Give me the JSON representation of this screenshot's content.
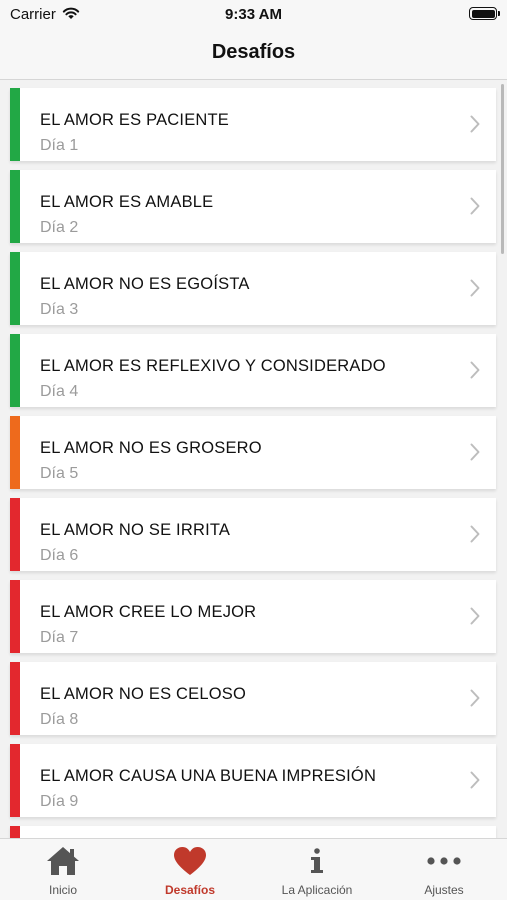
{
  "status_bar": {
    "carrier": "Carrier",
    "time": "9:33 AM"
  },
  "nav": {
    "title": "Desafíos"
  },
  "challenges": [
    {
      "title": "EL AMOR ES PACIENTE",
      "day": "Día 1",
      "color": "#22a845"
    },
    {
      "title": "EL AMOR ES AMABLE",
      "day": "Día 2",
      "color": "#22a845"
    },
    {
      "title": "EL AMOR NO ES EGOÍSTA",
      "day": "Día 3",
      "color": "#22a845"
    },
    {
      "title": "EL AMOR ES REFLEXIVO Y CONSIDERADO",
      "day": "Día 4",
      "color": "#22a845"
    },
    {
      "title": "EL AMOR NO ES GROSERO",
      "day": "Día 5",
      "color": "#ee6a1c"
    },
    {
      "title": "EL AMOR NO SE IRRITA",
      "day": "Día 6",
      "color": "#e3282e"
    },
    {
      "title": "EL AMOR CREE LO MEJOR",
      "day": "Día 7",
      "color": "#e3282e"
    },
    {
      "title": "EL AMOR NO ES CELOSO",
      "day": "Día 8",
      "color": "#e3282e"
    },
    {
      "title": "EL AMOR CAUSA UNA BUENA IMPRESIÓN",
      "day": "Día 9",
      "color": "#e3282e"
    },
    {
      "title": "",
      "day": "",
      "color": "#e3282e"
    }
  ],
  "tabs": [
    {
      "label": "Inicio",
      "icon": "home-icon"
    },
    {
      "label": "Desafíos",
      "icon": "heart-icon"
    },
    {
      "label": "La Aplicación",
      "icon": "info-icon"
    },
    {
      "label": "Ajustes",
      "icon": "more-icon"
    }
  ],
  "colors": {
    "active_tab": "#c0392b",
    "inactive_icon": "#555555"
  }
}
